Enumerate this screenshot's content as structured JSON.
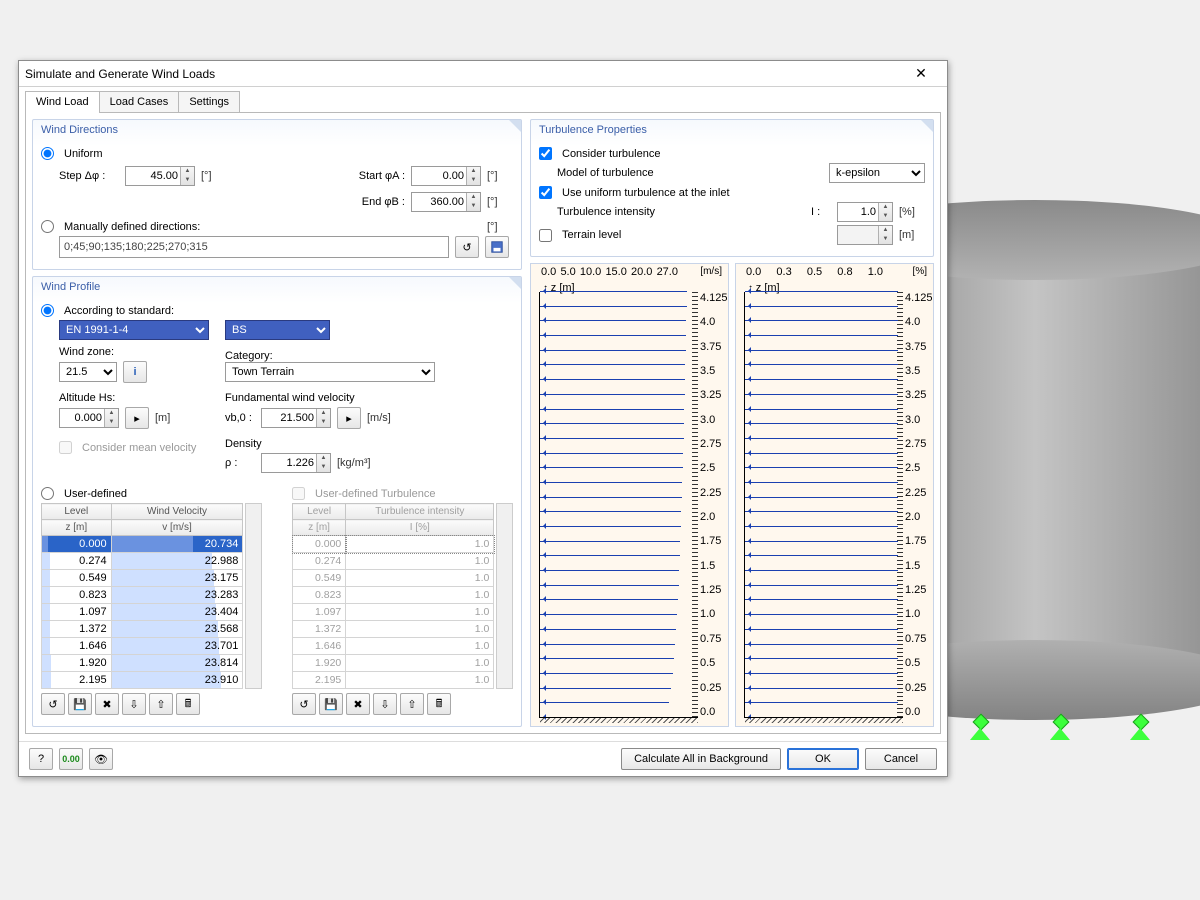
{
  "window": {
    "title": "Simulate and Generate Wind Loads"
  },
  "tabs": [
    "Wind Load",
    "Load Cases",
    "Settings"
  ],
  "activeTab": 0,
  "windDirections": {
    "legend": "Wind Directions",
    "mode": "uniform",
    "uniformLabel": "Uniform",
    "stepLabel": "Step Δφ :",
    "stepValue": "45.00",
    "stepUnit": "[°]",
    "startLabel": "Start φA :",
    "startValue": "0.00",
    "startUnit": "[°]",
    "endLabel": "End φB :",
    "endValue": "360.00",
    "endUnit": "[°]",
    "manualLabel": "Manually defined directions:",
    "manualUnit": "[°]",
    "manualValue": "0;45;90;135;180;225;270;315"
  },
  "windProfile": {
    "legend": "Wind Profile",
    "accordingLabel": "According to standard:",
    "standard": "EN 1991-1-4",
    "annex": "BS",
    "windZoneLabel": "Wind zone:",
    "windZone": "21.5",
    "categoryLabel": "Category:",
    "category": "Town Terrain",
    "altitudeLabel": "Altitude Hs:",
    "altitudeValue": "0.000",
    "altitudeUnit": "[m]",
    "fundLabel": "Fundamental wind velocity",
    "vbLabel": "vb,0 :",
    "vbValue": "21.500",
    "vbUnit": "[m/s]",
    "meanLabel": "Consider mean velocity",
    "densityLabel": "Density",
    "rhoLabel": "ρ :",
    "rhoValue": "1.226",
    "rhoUnit": "[kg/m³]",
    "userDefinedLabel": "User-defined",
    "userTurbLabel": "User-defined Turbulence",
    "velHeaders": {
      "level": "Level",
      "z": "z [m]",
      "wv": "Wind Velocity",
      "v": "v [m/s]"
    },
    "turbHeaders": {
      "level": "Level",
      "z": "z [m]",
      "ti": "Turbulence intensity",
      "I": "I [%]"
    },
    "velRows": [
      {
        "z": "0.000",
        "v": "20.734",
        "bar": 0.62
      },
      {
        "z": "0.274",
        "v": "22.988",
        "bar": 0.77
      },
      {
        "z": "0.549",
        "v": "23.175",
        "bar": 0.78
      },
      {
        "z": "0.823",
        "v": "23.283",
        "bar": 0.79
      },
      {
        "z": "1.097",
        "v": "23.404",
        "bar": 0.8
      },
      {
        "z": "1.372",
        "v": "23.568",
        "bar": 0.81
      },
      {
        "z": "1.646",
        "v": "23.701",
        "bar": 0.82
      },
      {
        "z": "1.920",
        "v": "23.814",
        "bar": 0.83
      },
      {
        "z": "2.195",
        "v": "23.910",
        "bar": 0.84
      }
    ],
    "turbRows": [
      {
        "z": "0.000",
        "I": "1.0"
      },
      {
        "z": "0.274",
        "I": "1.0"
      },
      {
        "z": "0.549",
        "I": "1.0"
      },
      {
        "z": "0.823",
        "I": "1.0"
      },
      {
        "z": "1.097",
        "I": "1.0"
      },
      {
        "z": "1.372",
        "I": "1.0"
      },
      {
        "z": "1.646",
        "I": "1.0"
      },
      {
        "z": "1.920",
        "I": "1.0"
      },
      {
        "z": "2.195",
        "I": "1.0"
      }
    ]
  },
  "turbulence": {
    "legend": "Turbulence Properties",
    "considerLabel": "Consider turbulence",
    "modelLabel": "Model of turbulence",
    "modelValue": "k-epsilon",
    "uniformInletLabel": "Use uniform turbulence at the inlet",
    "intensityLabel": "Turbulence intensity",
    "ILabel": "I :",
    "IValue": "1.0",
    "IUnit": "[%]",
    "terrainLabel": "Terrain level",
    "terrainUnit": "[m]"
  },
  "chart_data": [
    {
      "type": "line",
      "title": "",
      "xlabel": "[m/s]",
      "ylabel": "z [m]",
      "x_ticks": [
        "0.0",
        "5.0",
        "10.0",
        "15.0",
        "20.0",
        "27.0"
      ],
      "ylim": [
        0.0,
        4.125
      ],
      "y_ticks": [
        "0.0",
        "0.25",
        "0.5",
        "0.75",
        "1.0",
        "1.25",
        "1.5",
        "1.75",
        "2.0",
        "2.25",
        "2.5",
        "2.75",
        "3.0",
        "3.25",
        "3.5",
        "3.75",
        "4.0",
        "4.125"
      ],
      "series": [
        {
          "name": "wind velocity",
          "x": [
            20.734,
            22.988,
            23.175,
            23.283,
            23.404,
            23.568,
            23.701,
            23.814,
            23.91
          ],
          "y": [
            0.0,
            0.274,
            0.549,
            0.823,
            1.097,
            1.372,
            1.646,
            1.92,
            2.195
          ]
        }
      ]
    },
    {
      "type": "line",
      "title": "",
      "xlabel": "[%]",
      "ylabel": "z [m]",
      "x_ticks": [
        "0.0",
        "0.3",
        "0.5",
        "0.8",
        "1.0"
      ],
      "ylim": [
        0.0,
        4.125
      ],
      "y_ticks": [
        "0.0",
        "0.25",
        "0.5",
        "0.75",
        "1.0",
        "1.25",
        "1.5",
        "1.75",
        "2.0",
        "2.25",
        "2.5",
        "2.75",
        "3.0",
        "3.25",
        "3.5",
        "3.75",
        "4.0",
        "4.125"
      ],
      "series": [
        {
          "name": "turbulence intensity",
          "x": [
            1.0,
            1.0,
            1.0,
            1.0,
            1.0,
            1.0,
            1.0,
            1.0,
            1.0
          ],
          "y": [
            0.0,
            0.274,
            0.549,
            0.823,
            1.097,
            1.372,
            1.646,
            1.92,
            2.195
          ]
        }
      ]
    }
  ],
  "footer": {
    "calcAll": "Calculate All in Background",
    "ok": "OK",
    "cancel": "Cancel"
  }
}
